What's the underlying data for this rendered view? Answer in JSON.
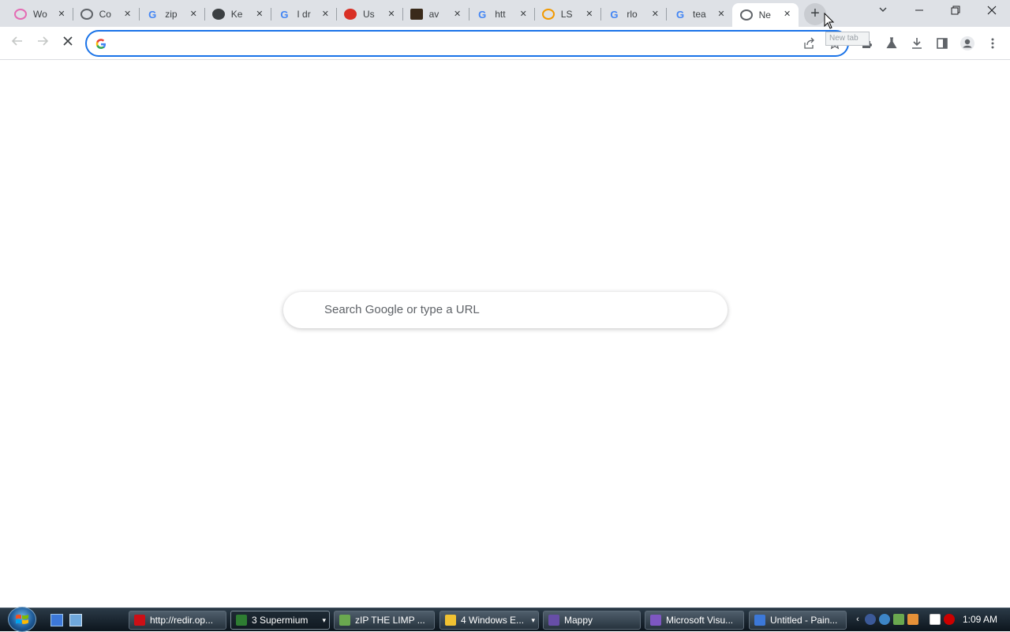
{
  "tabs": [
    {
      "label": "Wo",
      "icon": "flower-icon",
      "color": "#e46bb3"
    },
    {
      "label": "Co",
      "icon": "globe-icon",
      "color": "#5f6368"
    },
    {
      "label": "zip",
      "icon": "google-g-icon",
      "color": "#4285f4"
    },
    {
      "label": "Ke",
      "icon": "bug-icon",
      "color": "#3c4043"
    },
    {
      "label": "I dr",
      "icon": "google-g-icon",
      "color": "#4285f4"
    },
    {
      "label": "Us",
      "icon": "flame-icon",
      "color": "#d93025"
    },
    {
      "label": "av",
      "icon": "image-icon",
      "color": "#3a2a1a"
    },
    {
      "label": "htt",
      "icon": "google-g-icon",
      "color": "#4285f4"
    },
    {
      "label": "LS",
      "icon": "rainbow-icon",
      "color": "#f29900"
    },
    {
      "label": "rlo",
      "icon": "google-g-icon",
      "color": "#4285f4"
    },
    {
      "label": "tea",
      "icon": "google-g-icon",
      "color": "#4285f4"
    },
    {
      "label": "Ne",
      "icon": "chromium-icon",
      "color": "#5f6368",
      "active": true
    }
  ],
  "newtab_tooltip": "New tab",
  "omnibox": {
    "value": "",
    "placeholder": ""
  },
  "search": {
    "placeholder": "Search Google or type a URL"
  },
  "taskbar": {
    "buttons": [
      {
        "label": "http://redir.op...",
        "icon": "opera-icon",
        "color": "#cc0f16"
      },
      {
        "label": "3 Supermium",
        "icon": "supermium-icon",
        "color": "#2e7d32",
        "active": true,
        "arrow": "▾"
      },
      {
        "label": "zIP THE LIMP ...",
        "icon": "image-icon",
        "color": "#6aa84f"
      },
      {
        "label": "4 Windows E...",
        "icon": "folder-icon",
        "color": "#f1c232",
        "arrow": "▾"
      },
      {
        "label": "Mappy",
        "icon": "mappy-icon",
        "color": "#674ea7"
      },
      {
        "label": "Microsoft Visu...",
        "icon": "visual-studio-icon",
        "color": "#7e57c2"
      },
      {
        "label": "Untitled - Pain...",
        "icon": "paint-icon",
        "color": "#3c78d8"
      }
    ],
    "clock": "1:09 AM"
  }
}
